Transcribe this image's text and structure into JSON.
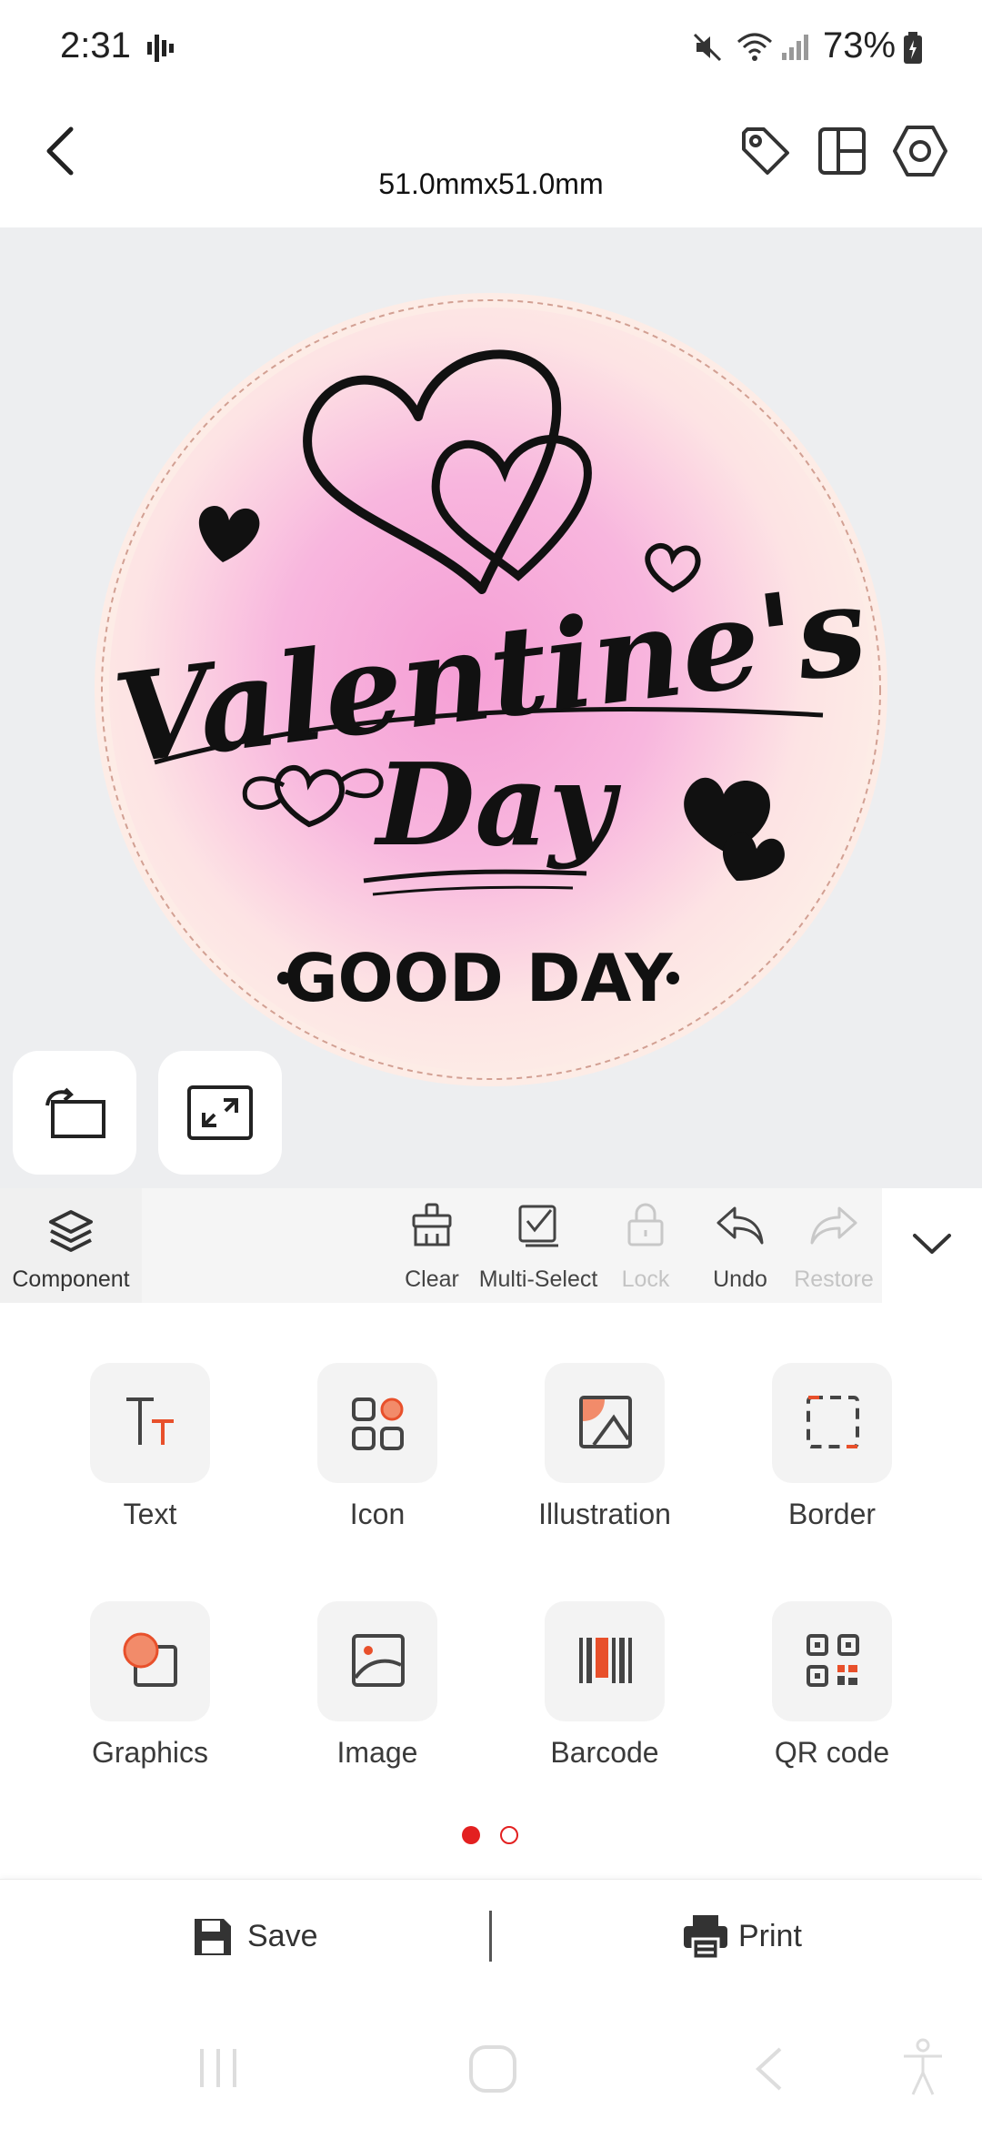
{
  "status": {
    "time": "2:31",
    "battery_pct": "73%"
  },
  "header": {
    "size": "51.0mmx51.0mm",
    "icons": [
      "back-icon",
      "tag-icon",
      "layout-icon",
      "settings-icon"
    ]
  },
  "canvas": {
    "label": {
      "title_line1": "Valentine's",
      "title_line2": "Day",
      "subtitle": "GOOD DAY",
      "colors": {
        "bg": "#fdece6",
        "glow": "#f59ed5",
        "ink": "#111111",
        "edge": "#e7b9ac"
      }
    }
  },
  "toolbar": {
    "component_label": "Component",
    "tools": [
      {
        "label": "Clear",
        "icon": "brush-icon",
        "enabled": true
      },
      {
        "label": "Multi-Select",
        "icon": "multiselect-icon",
        "enabled": true
      },
      {
        "label": "Lock",
        "icon": "lock-icon",
        "enabled": false
      },
      {
        "label": "Undo",
        "icon": "undo-icon",
        "enabled": true
      },
      {
        "label": "Restore",
        "icon": "redo-icon",
        "enabled": false
      }
    ]
  },
  "components": [
    {
      "label": "Text",
      "icon": "text-icon"
    },
    {
      "label": "Icon",
      "icon": "icon-grid-icon"
    },
    {
      "label": "Illustration",
      "icon": "illustration-icon"
    },
    {
      "label": "Border",
      "icon": "border-icon"
    },
    {
      "label": "Graphics",
      "icon": "graphics-icon"
    },
    {
      "label": "Image",
      "icon": "image-icon"
    },
    {
      "label": "Barcode",
      "icon": "barcode-icon"
    },
    {
      "label": "QR code",
      "icon": "qrcode-icon"
    }
  ],
  "pager": {
    "pages": 2,
    "current": 1
  },
  "actions": {
    "save": "Save",
    "print": "Print"
  },
  "accent": "#e8502b",
  "pager_color": "#e32020"
}
